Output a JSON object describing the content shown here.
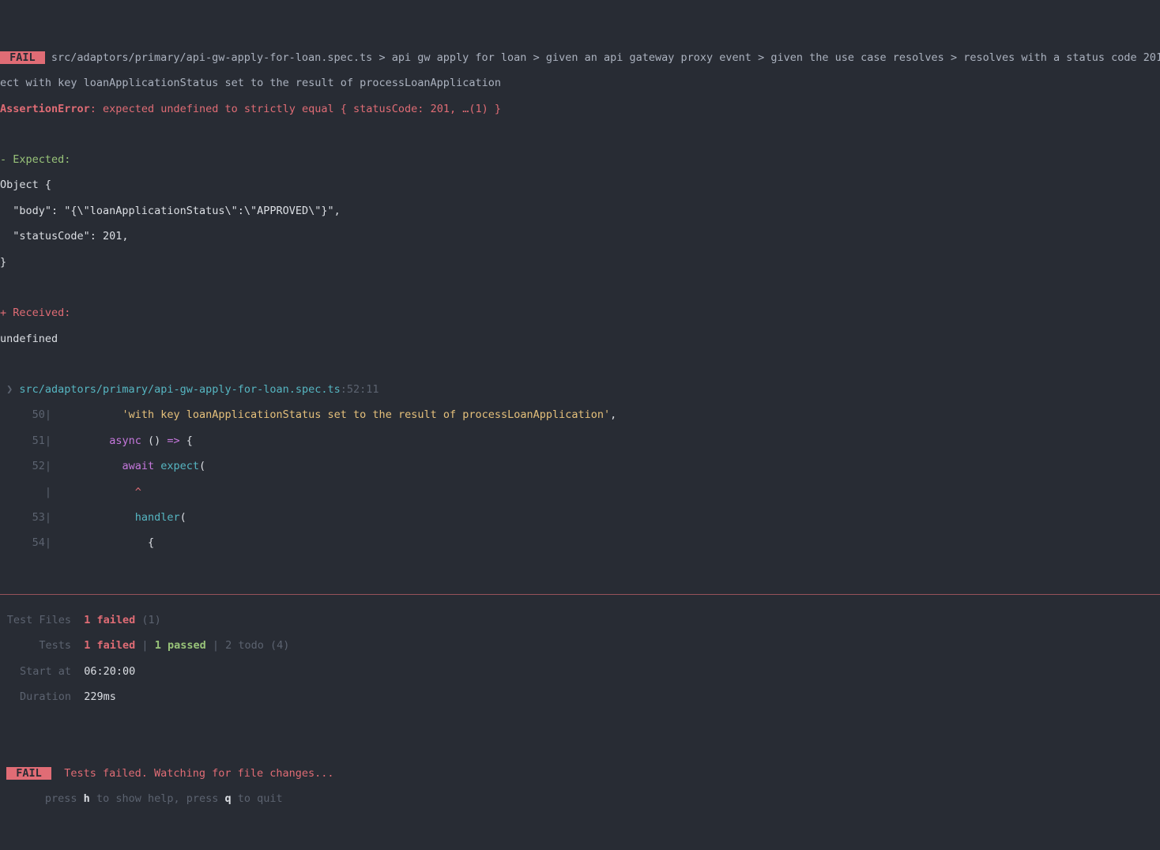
{
  "fail_badge": " FAIL ",
  "test_path": "src/adaptors/primary/api-gw-apply-for-loan.spec.ts",
  "crumb1": "api gw apply for loan",
  "crumb2": "given an api gateway proxy event",
  "crumb3": "given the use case resolves",
  "crumb4": "resolves with a status code 201",
  "title_wrap": "ect with key loanApplicationStatus set to the result of processLoanApplication",
  "assertion_name": "AssertionError",
  "assertion_msg": ": expected undefined to strictly equal { statusCode: 201, …(1) }",
  "expected_label": "- Expected:",
  "expected_lines": {
    "l0": "Object {",
    "l1": "  \"body\": \"{\\\"loanApplicationStatus\\\":\\\"APPROVED\\\"}\",",
    "l2": "  \"statusCode\": 201,",
    "l3": "}"
  },
  "received_label": "+ Received:",
  "received_value": "undefined",
  "stack_caret": " ❯ ",
  "stack_file": "src/adaptors/primary/api-gw-apply-for-loan.spec.ts",
  "stack_loc": ":52:11",
  "code": {
    "n50": "50",
    "l50a": "'with key loanApplicationStatus set to the result of processLoanApplication'",
    "l50b": ",",
    "n51": "51",
    "l51_async": "async",
    "l51_paren": " () ",
    "l51_arrow": "=>",
    "l51_brace": " {",
    "n52": "52",
    "l52_await": "await",
    "l52_expect": " expect",
    "l52_paren": "(",
    "caret_line": "            ^",
    "n53": "53",
    "l53_handler": "handler",
    "l53_paren": "(",
    "n54": "54",
    "l54": "{"
  },
  "summary": {
    "test_files_label": "Test Files",
    "test_files_failed": "1 failed",
    "test_files_total": " (1)",
    "tests_label": "Tests",
    "tests_failed": "1 failed",
    "tests_sep": " | ",
    "tests_passed": "1 passed",
    "tests_rest": " | 2 todo (4)",
    "start_label": "Start at",
    "start_value": "06:20:00",
    "duration_label": "Duration",
    "duration_value": "229ms"
  },
  "footer": {
    "fail_badge": " FAIL ",
    "watching": "Tests failed. Watching for file changes...",
    "help_prefix": "       press ",
    "help_h": "h",
    "help_mid": " to show help, press ",
    "help_q": "q",
    "help_suffix": " to quit"
  }
}
